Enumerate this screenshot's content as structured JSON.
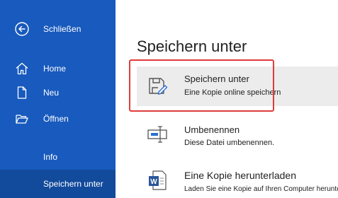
{
  "sidebar": {
    "back_label": "Schließen",
    "items": [
      {
        "label": "Home",
        "icon": "home-icon"
      },
      {
        "label": "Neu",
        "icon": "new-document-icon"
      },
      {
        "label": "Öffnen",
        "icon": "open-folder-icon"
      },
      {
        "label": "Info",
        "icon": ""
      },
      {
        "label": "Speichern unter",
        "icon": "",
        "selected": true
      }
    ]
  },
  "main": {
    "title": "Speichern unter",
    "options": [
      {
        "title": "Speichern unter",
        "subtitle": "Eine Kopie online speichern",
        "icon": "save-as-icon",
        "highlighted": true
      },
      {
        "title": "Umbenennen",
        "subtitle": "Diese Datei umbenennen.",
        "icon": "rename-icon"
      },
      {
        "title": "Eine Kopie herunterladen",
        "subtitle": "Laden Sie eine Kopie auf Ihren Computer herunter.",
        "icon": "word-document-icon"
      }
    ]
  },
  "colors": {
    "sidebar_bg": "#185abd",
    "sidebar_selected_bg": "#124a9c",
    "highlight_border": "#e03c3c",
    "word_blue": "#2b579a"
  }
}
